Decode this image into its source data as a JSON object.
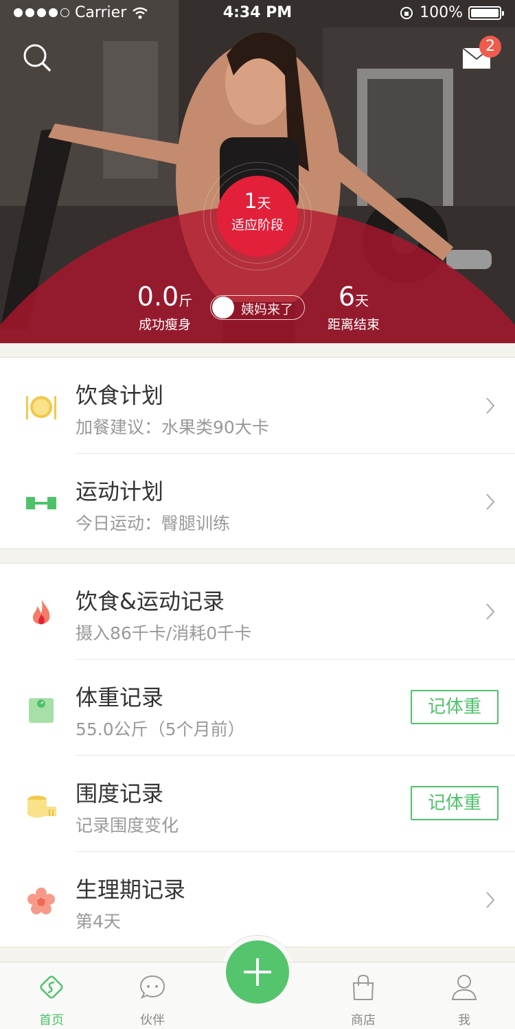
{
  "status_bar": {
    "carrier": "Carrier",
    "time": "4:34 PM",
    "battery": "100%"
  },
  "hero": {
    "badge_count": "2",
    "phase": {
      "days_value": "1",
      "days_unit": "天",
      "label": "适应阶段"
    },
    "lost": {
      "value": "0.0",
      "unit": "斤",
      "caption": "成功瘦身"
    },
    "remaining": {
      "value": "6",
      "unit": "天",
      "caption": "距离结束"
    },
    "period_toggle_label": "姨妈来了"
  },
  "plans": [
    {
      "title": "饮食计划",
      "subtitle": "加餐建议：水果类90大卡",
      "icon": "plate-icon"
    },
    {
      "title": "运动计划",
      "subtitle": "今日运动：臀腿训练",
      "icon": "dumbbell-icon"
    }
  ],
  "records": [
    {
      "title": "饮食&运动记录",
      "subtitle": "摄入86千卡/消耗0千卡",
      "icon": "flame-icon"
    },
    {
      "title": "体重记录",
      "subtitle": "55.0公斤（5个月前）",
      "icon": "scale-icon",
      "button": "记体重"
    },
    {
      "title": "围度记录",
      "subtitle": "记录围度变化",
      "icon": "tape-measure-icon",
      "button": "记体重"
    },
    {
      "title": "生理期记录",
      "subtitle": "第4天",
      "icon": "flower-icon"
    }
  ],
  "tabs": [
    {
      "label": "首页",
      "icon": "home-icon",
      "active": true
    },
    {
      "label": "伙伴",
      "icon": "chat-icon",
      "active": false
    },
    {
      "label": "商店",
      "icon": "bag-icon",
      "active": false
    },
    {
      "label": "我",
      "icon": "profile-icon",
      "active": false
    }
  ],
  "colors": {
    "accent_green": "#4dc26a",
    "hero_red": "#e2203a",
    "badge_red": "#ef5b4c"
  }
}
